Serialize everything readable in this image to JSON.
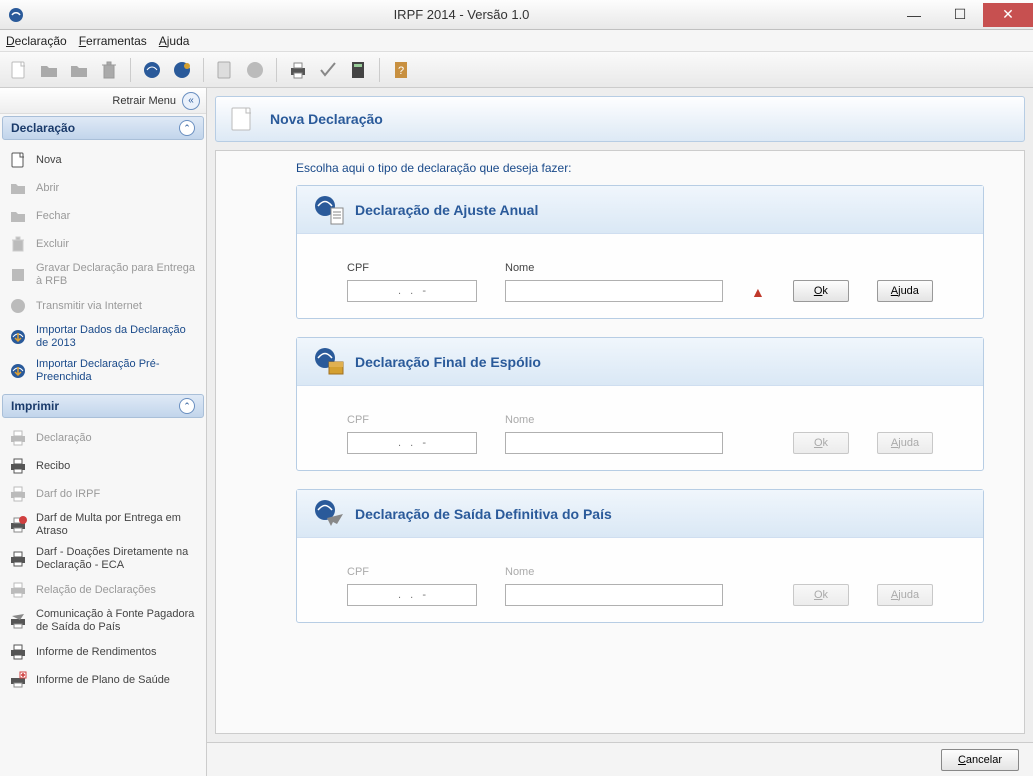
{
  "window": {
    "title": "IRPF 2014 - Versão 1.0"
  },
  "menubar": {
    "items": [
      {
        "prefix": "D",
        "rest": "eclaração"
      },
      {
        "prefix": "F",
        "rest": "erramentas"
      },
      {
        "prefix": "A",
        "rest": "juda"
      }
    ]
  },
  "sidebar": {
    "retract_label": "Retrair Menu",
    "sections": {
      "declaracao": {
        "title": "Declaração",
        "items": [
          {
            "label": "Nova",
            "icon": "document-icon",
            "disabled": false
          },
          {
            "label": "Abrir",
            "icon": "folder-icon",
            "disabled": true
          },
          {
            "label": "Fechar",
            "icon": "folder-icon",
            "disabled": true
          },
          {
            "label": "Excluir",
            "icon": "trash-icon",
            "disabled": true
          },
          {
            "label": "Gravar Declaração para Entrega à RFB",
            "icon": "save-icon",
            "disabled": true
          },
          {
            "label": "Transmitir via Internet",
            "icon": "globe-icon",
            "disabled": true
          },
          {
            "label": "Importar Dados da Declaração de 2013",
            "icon": "import-icon",
            "disabled": false,
            "active": true
          },
          {
            "label": "Importar Declaração Pré-Preenchida",
            "icon": "import-icon",
            "disabled": false,
            "active": true
          }
        ]
      },
      "imprimir": {
        "title": "Imprimir",
        "items": [
          {
            "label": "Declaração",
            "icon": "printer-icon",
            "disabled": true
          },
          {
            "label": "Recibo",
            "icon": "printer-icon",
            "disabled": false
          },
          {
            "label": "Darf do IRPF",
            "icon": "printer-icon",
            "disabled": true
          },
          {
            "label": "Darf de Multa por Entrega em Atraso",
            "icon": "printer-multa-icon",
            "disabled": false
          },
          {
            "label": "Darf - Doações Diretamente na Declaração - ECA",
            "icon": "printer-icon",
            "disabled": false
          },
          {
            "label": "Relação de Declarações",
            "icon": "printer-icon",
            "disabled": true
          },
          {
            "label": "Comunicação à Fonte Pagadora de Saída do País",
            "icon": "printer-plane-icon",
            "disabled": false
          },
          {
            "label": "Informe de Rendimentos",
            "icon": "printer-icon",
            "disabled": false
          },
          {
            "label": "Informe de Plano de Saúde",
            "icon": "printer-health-icon",
            "disabled": false
          }
        ]
      }
    }
  },
  "main": {
    "page_title": "Nova Declaração",
    "instruction": "Escolha aqui o tipo de declaração que deseja fazer:",
    "cards": [
      {
        "title": "Declaração de Ajuste Anual",
        "cpf_label": "CPF",
        "cpf_placeholder": ".   .   -",
        "nome_label": "Nome",
        "ok_label": "Ok",
        "ajuda_label": "Ajuda",
        "active": true,
        "show_warning": true
      },
      {
        "title": "Declaração Final de Espólio",
        "cpf_label": "CPF",
        "cpf_placeholder": ".   .   -",
        "nome_label": "Nome",
        "ok_label": "Ok",
        "ajuda_label": "Ajuda",
        "active": false,
        "show_warning": false
      },
      {
        "title": "Declaração de Saída Definitiva do País",
        "cpf_label": "CPF",
        "cpf_placeholder": ".   .   -",
        "nome_label": "Nome",
        "ok_label": "Ok",
        "ajuda_label": "Ajuda",
        "active": false,
        "show_warning": false
      }
    ],
    "cancel_label": "Cancelar"
  }
}
